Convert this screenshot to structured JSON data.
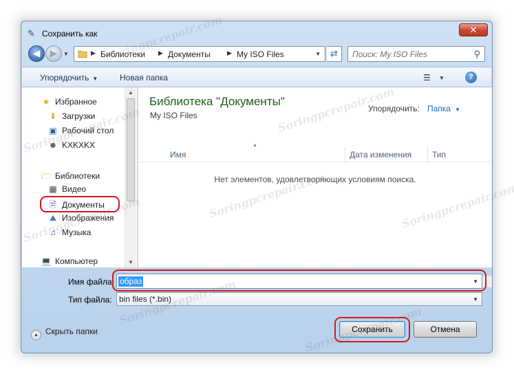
{
  "window": {
    "title": "Сохранить как",
    "close_symbol": "✕"
  },
  "nav": {
    "back_symbol": "◀",
    "forward_symbol": "▶",
    "address_segments": [
      "Библиотеки",
      "Документы",
      "My ISO Files"
    ],
    "search_placeholder": "Поиск: My ISO Files"
  },
  "toolbar": {
    "organize_label": "Упорядочить",
    "new_folder_label": "Новая папка"
  },
  "sidebar": {
    "items": [
      {
        "label": "Избранное",
        "icon": "star-icon"
      },
      {
        "label": "Загрузки",
        "icon": "downloads-folder-icon"
      },
      {
        "label": "Рабочий стол",
        "icon": "desktop-icon"
      },
      {
        "label": "KXKXKX",
        "icon": "user-icon"
      },
      {
        "label": "Библиотеки",
        "icon": "libraries-icon"
      },
      {
        "label": "Видео",
        "icon": "video-icon"
      },
      {
        "label": "Документы",
        "icon": "documents-icon"
      },
      {
        "label": "Изображения",
        "icon": "pictures-icon"
      },
      {
        "label": "Музыка",
        "icon": "music-icon"
      },
      {
        "label": "Компьютер",
        "icon": "computer-icon"
      }
    ],
    "selected": "Документы"
  },
  "content": {
    "library_title": "Библиотека \"Документы\"",
    "library_subtitle": "My ISO Files",
    "arrange_label": "Упорядочить:",
    "arrange_value": "Папка",
    "columns": [
      "Имя",
      "Дата изменения",
      "Тип"
    ],
    "empty_message": "Нет элементов, удовлетворяющих условиям поиска."
  },
  "form": {
    "filename_label": "Имя файла:",
    "filename_value": "образ",
    "filetype_label": "Тип файла:",
    "filetype_value": "bin files (*.bin)"
  },
  "footer": {
    "hide_folders_label": "Скрыть папки",
    "save_label": "Сохранить",
    "cancel_label": "Отмена"
  },
  "watermark": "Soringpcrepair.com",
  "colors": {
    "accent_ring": "#d4161b",
    "library_title": "#1d5e15",
    "link_blue": "#1b66b4",
    "selection": "#3399ff"
  }
}
